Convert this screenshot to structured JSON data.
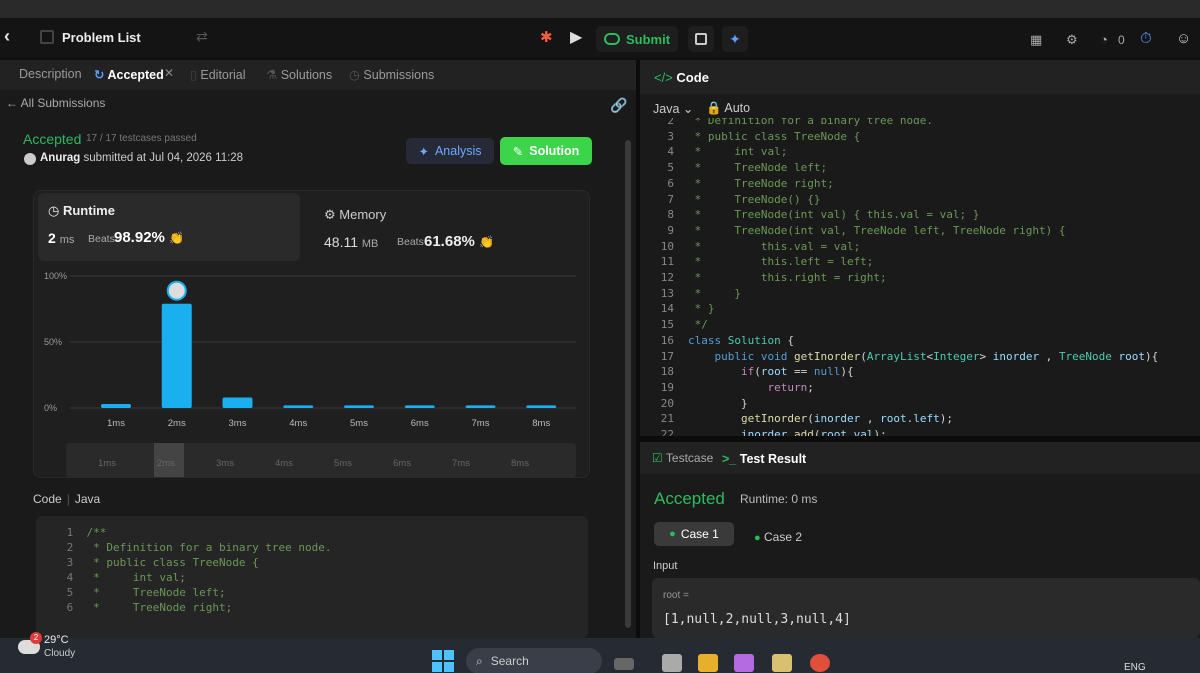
{
  "topbar": {
    "title": "Problem List",
    "submit_label": "Submit",
    "count": "0"
  },
  "tabs": {
    "description": "Description",
    "accepted": "Accepted",
    "editorial": "Editorial",
    "solutions": "Solutions",
    "submissions": "Submissions"
  },
  "submission": {
    "back_label": "All Submissions",
    "status": "Accepted",
    "testcases": "17 / 17 testcases passed",
    "user": "Anurag",
    "submitted_text": "submitted at Jul 04, 2026 11:28",
    "analysis_label": "Analysis",
    "solution_label": "Solution"
  },
  "runtime": {
    "title": "Runtime",
    "value": "2",
    "unit": "ms",
    "beats_label": "Beats",
    "beats_pct": "98.92%"
  },
  "memory": {
    "title": "Memory",
    "value": "48.11",
    "unit": "MB",
    "beats_label": "Beats",
    "beats_pct": "61.68%"
  },
  "chart_data": {
    "type": "bar",
    "categories": [
      "1ms",
      "2ms",
      "3ms",
      "4ms",
      "5ms",
      "6ms",
      "7ms",
      "8ms"
    ],
    "values": [
      3,
      79,
      8,
      2,
      2,
      2,
      2,
      2
    ],
    "y_ticks": [
      "100%",
      "50%",
      "0%"
    ],
    "ylim": [
      0,
      100
    ],
    "highlight_category": "2ms",
    "bar_color": "#1ab0f0",
    "grid": true
  },
  "range_labels": [
    "1ms",
    "2ms",
    "3ms",
    "4ms",
    "5ms",
    "6ms",
    "7ms",
    "8ms"
  ],
  "code_header": {
    "label": "Code",
    "lang": "Java"
  },
  "left_code": [
    {
      "n": "1",
      "t": "/**"
    },
    {
      "n": "2",
      "t": " * Definition for a binary tree node."
    },
    {
      "n": "3",
      "t": " * public class TreeNode {"
    },
    {
      "n": "4",
      "t": " *     int val;"
    },
    {
      "n": "5",
      "t": " *     TreeNode left;"
    },
    {
      "n": "6",
      "t": " *     TreeNode right;"
    }
  ],
  "editor": {
    "title": "Code",
    "lang": "Java",
    "mode": "Auto"
  },
  "editor_lines": [
    {
      "n": "2",
      "t": " * Definition for a binary tree node.",
      "c": "cm"
    },
    {
      "n": "3",
      "t": " * public class TreeNode {",
      "c": "cm"
    },
    {
      "n": "4",
      "t": " *     int val;",
      "c": "cm"
    },
    {
      "n": "5",
      "t": " *     TreeNode left;",
      "c": "cm"
    },
    {
      "n": "6",
      "t": " *     TreeNode right;",
      "c": "cm"
    },
    {
      "n": "7",
      "t": " *     TreeNode() {}",
      "c": "cm"
    },
    {
      "n": "8",
      "t": " *     TreeNode(int val) { this.val = val; }",
      "c": "cm"
    },
    {
      "n": "9",
      "t": " *     TreeNode(int val, TreeNode left, TreeNode right) {",
      "c": "cm"
    },
    {
      "n": "10",
      "t": " *         this.val = val;",
      "c": "cm"
    },
    {
      "n": "11",
      "t": " *         this.left = left;",
      "c": "cm"
    },
    {
      "n": "12",
      "t": " *         this.right = right;",
      "c": "cm"
    },
    {
      "n": "13",
      "t": " *     }",
      "c": "cm"
    },
    {
      "n": "14",
      "t": " * }",
      "c": "cm"
    },
    {
      "n": "15",
      "t": " */",
      "c": "cm"
    },
    {
      "n": "16",
      "t": "class Solution {",
      "c": "code"
    },
    {
      "n": "17",
      "t": "    public void getInorder(ArrayList<Integer> inorder , TreeNode root){",
      "c": "code"
    },
    {
      "n": "18",
      "t": "        if(root == null){",
      "c": "code"
    },
    {
      "n": "19",
      "t": "            return;",
      "c": "code"
    },
    {
      "n": "20",
      "t": "        }",
      "c": "code"
    },
    {
      "n": "21",
      "t": "        getInorder(inorder , root.left);",
      "c": "code"
    },
    {
      "n": "22",
      "t": "        inorder.add(root.val);",
      "c": "code"
    }
  ],
  "testpanel": {
    "testcase_tab": "Testcase",
    "result_tab": "Test Result",
    "status": "Accepted",
    "runtime": "Runtime: 0 ms",
    "case1": "Case 1",
    "case2": "Case 2",
    "input_label": "Input",
    "var_label": "root =",
    "var_value": "[1,null,2,null,3,null,4]"
  },
  "taskbar": {
    "badge": "2",
    "temp": "29°C",
    "condition": "Cloudy",
    "search_label": "Search",
    "lang": "ENG"
  }
}
